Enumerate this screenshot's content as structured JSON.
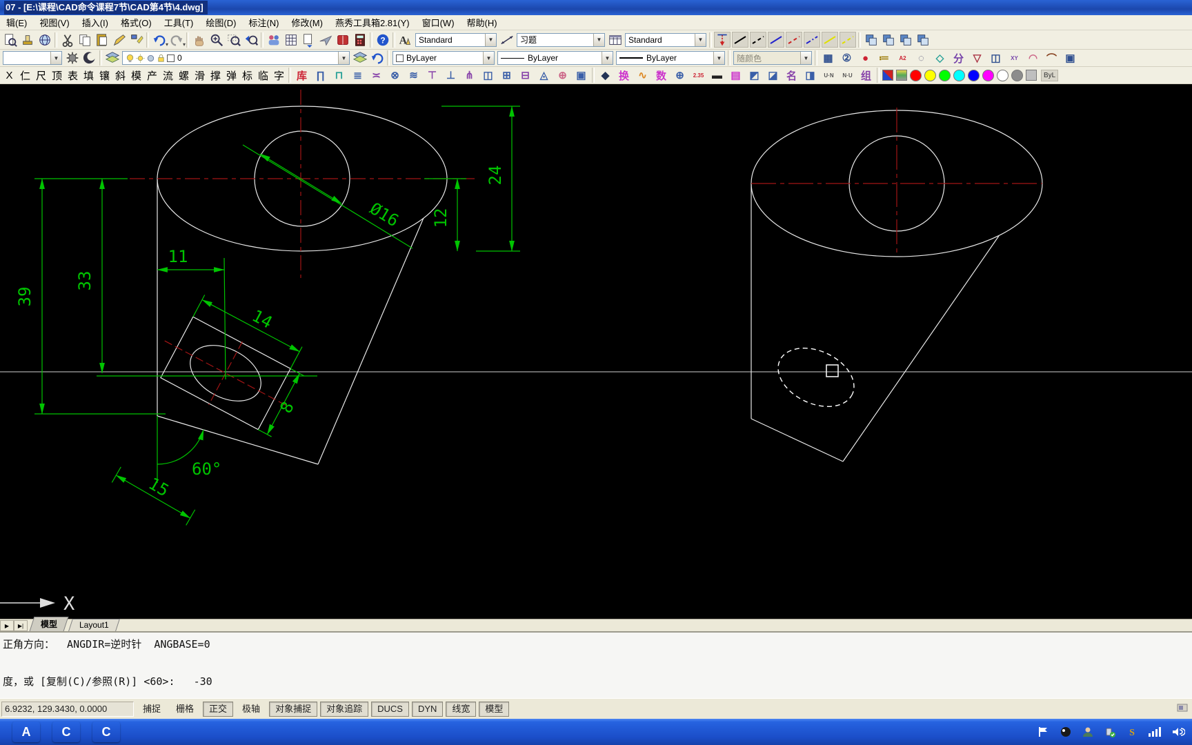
{
  "window": {
    "title": "07 - [E:\\课程\\CAD命令课程7节\\CAD第4节\\4.dwg]"
  },
  "menu": {
    "items": [
      "辑(E)",
      "视图(V)",
      "插入(I)",
      "格式(O)",
      "工具(T)",
      "绘图(D)",
      "标注(N)",
      "修改(M)",
      "燕秀工具箱2.81(Y)",
      "窗口(W)",
      "帮助(H)"
    ]
  },
  "toolbars": {
    "row2_icons": [
      {
        "cls": "tbtn",
        "icon": "#i-preview"
      },
      {
        "cls": "tbtn",
        "icon": "#i-stamp"
      },
      {
        "cls": "tbtn",
        "icon": "#i-globe"
      },
      {
        "cls": "tsep"
      },
      {
        "cls": "tbtn",
        "icon": "#i-cut"
      },
      {
        "cls": "tbtn",
        "icon": "#i-copy"
      },
      {
        "cls": "tbtn",
        "icon": "#i-paste"
      },
      {
        "cls": "tbtn",
        "icon": "#i-pencil"
      },
      {
        "cls": "tbtn",
        "icon": "#i-brush"
      },
      {
        "cls": "tsep"
      },
      {
        "cls": "tbtn drop",
        "icon": "#i-undo"
      },
      {
        "cls": "tbtn drop",
        "icon": "#i-redo"
      },
      {
        "cls": "tsep"
      },
      {
        "cls": "tbtn",
        "icon": "#i-hand"
      },
      {
        "cls": "tbtn",
        "icon": "#i-magpm"
      },
      {
        "cls": "tbtn",
        "icon": "#i-magwin"
      },
      {
        "cls": "tbtn",
        "icon": "#i-magprev"
      },
      {
        "cls": "tsep"
      },
      {
        "cls": "tbtn",
        "icon": "#i-people"
      },
      {
        "cls": "tbtn",
        "icon": "#i-grid"
      },
      {
        "cls": "tbtn",
        "icon": "#i-docarrow"
      },
      {
        "cls": "tbtn",
        "icon": "#i-plane"
      },
      {
        "cls": "tbtn",
        "icon": "#i-book"
      },
      {
        "cls": "tbtn",
        "icon": "#i-calc"
      },
      {
        "cls": "tsep"
      },
      {
        "cls": "tbtn",
        "icon": "#i-help"
      }
    ],
    "styles": {
      "text_style": "Standard",
      "dim_style": "习题",
      "table_style": "Standard"
    },
    "linetype_samples": [
      {
        "color": "#000000",
        "dash": ""
      },
      {
        "color": "#000000",
        "dash": "5 4"
      },
      {
        "color": "#2222cc",
        "dash": ""
      },
      {
        "color": "#cc2222",
        "dash": "5 4"
      },
      {
        "color": "#2222cc",
        "dash": "7 3 2 3"
      },
      {
        "color": "#e0e000",
        "dash": ""
      },
      {
        "color": "#e0e000",
        "dash": "5 4"
      }
    ],
    "layer": {
      "current": "0"
    },
    "properties": {
      "color": "ByLayer",
      "linetype": "ByLayer",
      "lineweight": "ByLayer",
      "plot_style": "随颜色"
    },
    "row3_tool_glyphs": [
      {
        "g": "▦",
        "c": "#2f4f8f"
      },
      {
        "g": "②",
        "c": "#2f4f8f"
      },
      {
        "g": "●",
        "c": "#cc2233"
      },
      {
        "g": "≔",
        "c": "#997700"
      },
      {
        "g": "A2",
        "c": "#cc2233",
        "small": true
      },
      {
        "g": "◌",
        "c": "#555577"
      },
      {
        "g": "◇",
        "c": "#2aa198"
      },
      {
        "g": "分",
        "c": "#7744aa"
      },
      {
        "g": "▽",
        "c": "#aa3344"
      },
      {
        "g": "◫",
        "c": "#2f4f8f"
      },
      {
        "g": "XY",
        "c": "#7744aa",
        "small": true
      },
      {
        "g": "◠",
        "c": "#cc6688"
      },
      {
        "g": "⌒",
        "c": "#884422"
      },
      {
        "g": "▣",
        "c": "#2f4f8f"
      }
    ],
    "char_buttons": [
      "X",
      "仁",
      "尺",
      "顶",
      "表",
      "填",
      "镶",
      "斜",
      "模",
      "产",
      "流",
      "螺",
      "滑",
      "撑",
      "弹",
      "标",
      "临",
      "字"
    ],
    "row4_group_a": [
      {
        "g": "库",
        "c": "#cc2233"
      },
      {
        "g": "∏",
        "c": "#3a5fa8"
      },
      {
        "g": "⊓",
        "c": "#2aa198"
      },
      {
        "g": "≣",
        "c": "#3a5fa8"
      },
      {
        "g": "≍",
        "c": "#8844aa"
      },
      {
        "g": "⊗",
        "c": "#3a5fa8"
      },
      {
        "g": "≋",
        "c": "#3a5fa8"
      },
      {
        "g": "⊤",
        "c": "#8844aa"
      },
      {
        "g": "⊥",
        "c": "#3a5fa8"
      },
      {
        "g": "⋔",
        "c": "#8844aa"
      },
      {
        "g": "◫",
        "c": "#3a5fa8"
      },
      {
        "g": "⊞",
        "c": "#3a5fa8"
      },
      {
        "g": "⊟",
        "c": "#8844aa"
      },
      {
        "g": "◬",
        "c": "#3a5fa8"
      },
      {
        "g": "⊕",
        "c": "#cc6688"
      },
      {
        "g": "▣",
        "c": "#3a5fa8"
      }
    ],
    "row4_group_b": [
      {
        "g": "◆",
        "c": "#223355"
      },
      {
        "g": "换",
        "c": "#cc33cc"
      },
      {
        "g": "∿",
        "c": "#dd8822"
      },
      {
        "g": "数",
        "c": "#cc33cc"
      },
      {
        "g": "⊕",
        "c": "#3a5fa8"
      },
      {
        "g": "2.35",
        "c": "#cc2233",
        "small": true
      },
      {
        "g": "▬",
        "c": "#222222"
      },
      {
        "g": "▤",
        "c": "#cc33cc"
      },
      {
        "g": "◩",
        "c": "#3a5fa8"
      },
      {
        "g": "◪",
        "c": "#3a5fa8"
      },
      {
        "g": "名",
        "c": "#8844aa"
      },
      {
        "g": "◨",
        "c": "#3a5fa8"
      },
      {
        "g": "U·N",
        "c": "#555555",
        "small": true
      },
      {
        "g": "N·U",
        "c": "#555555",
        "small": true
      },
      {
        "g": "组",
        "c": "#8844aa"
      }
    ],
    "palette": [
      {
        "c": "#ff0000"
      },
      {
        "c": "#ffff00"
      },
      {
        "c": "#00ff00"
      },
      {
        "c": "#00ffff"
      },
      {
        "c": "#0000ff"
      },
      {
        "c": "#ff00ff"
      },
      {
        "c": "#ffffff"
      },
      {
        "c": "#8c8c8c"
      }
    ],
    "palette_byl": "ByL"
  },
  "drawing": {
    "dims": {
      "d39": "39",
      "d33": "33",
      "d24": "24",
      "d12": "12",
      "d16": "Ø16",
      "d11": "11",
      "d14": "14",
      "d8": "8",
      "d60": "60°",
      "d15": "15"
    },
    "ucs_label": "X"
  },
  "tabs": {
    "model": "模型",
    "layout": "Layout1"
  },
  "command": {
    "line1": "正角方向：  ANGDIR=逆时针  ANGBASE=0",
    "line2": "",
    "line3": "度，或 [复制(C)/参照(R)] <60>:   -30"
  },
  "status": {
    "coords": "6.9232, 129.3430, 0.0000",
    "buttons": [
      {
        "label": "捕捉",
        "on": false
      },
      {
        "label": "栅格",
        "on": false
      },
      {
        "label": "正交",
        "on": true
      },
      {
        "label": "极轴",
        "on": false
      },
      {
        "label": "对象捕捉",
        "on": true
      },
      {
        "label": "对象追踪",
        "on": true
      },
      {
        "label": "DUCS",
        "on": true
      },
      {
        "label": "DYN",
        "on": true
      },
      {
        "label": "线宽",
        "on": true
      },
      {
        "label": "模型",
        "on": true
      }
    ]
  },
  "taskbar": {
    "apps": [
      {
        "label": "A",
        "bg": "#14337f"
      },
      {
        "label": "C",
        "bg": "#f08b1d"
      },
      {
        "label": "C",
        "bg": "#e03c31"
      }
    ]
  }
}
